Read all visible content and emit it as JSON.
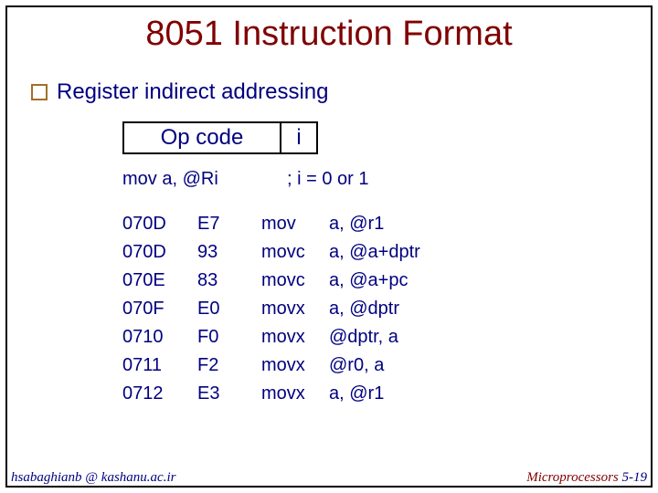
{
  "title": "8051 Instruction Format",
  "bullet": "Register indirect addressing",
  "diagram": {
    "opcode": "Op code",
    "ibit": "i"
  },
  "mov_line": {
    "lhs": "mov a, @Ri",
    "rhs": "; i = 0 or 1"
  },
  "rows": [
    {
      "addr": "070D",
      "hex": "E7",
      "mnemonic": "mov",
      "operands": "a, @r1"
    },
    {
      "addr": "070D",
      "hex": "93",
      "mnemonic": "movc",
      "operands": "a, @a+dptr"
    },
    {
      "addr": "070E",
      "hex": "83",
      "mnemonic": "movc",
      "operands": "a, @a+pc"
    },
    {
      "addr": "070F",
      "hex": "E0",
      "mnemonic": "movx",
      "operands": "a, @dptr"
    },
    {
      "addr": "0710",
      "hex": "F0",
      "mnemonic": "movx",
      "operands": "@dptr, a"
    },
    {
      "addr": "0711",
      "hex": "F2",
      "mnemonic": "movx",
      "operands": "@r0, a"
    },
    {
      "addr": "0712",
      "hex": "E3",
      "mnemonic": "movx",
      "operands": "a, @r1"
    }
  ],
  "footer": {
    "left": "hsabaghianb @ kashanu.ac.ir",
    "right_label": "Microprocessors",
    "page": "5-19"
  }
}
